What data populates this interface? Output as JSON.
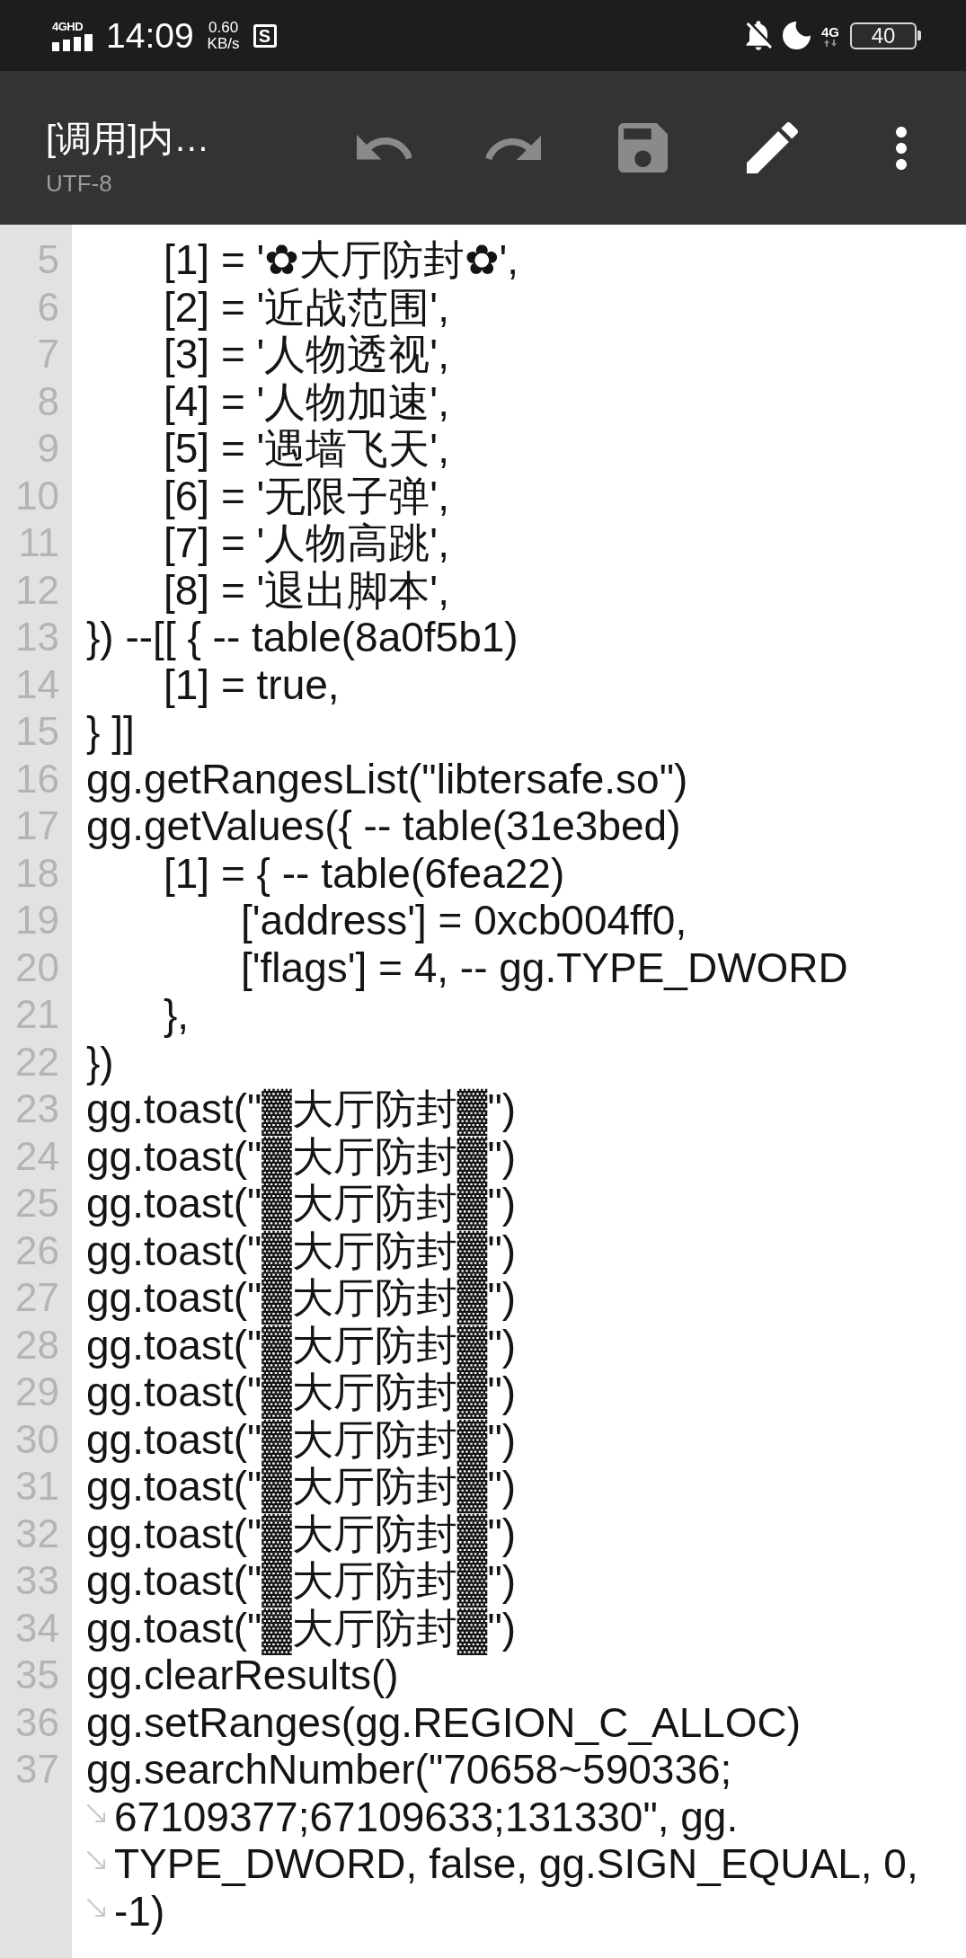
{
  "status_bar": {
    "network_type": "4GHD",
    "time": "14:09",
    "speed_value": "0.60",
    "speed_unit": "KB/s",
    "notification_letter": "S",
    "mobile_data": "4G",
    "battery": "40"
  },
  "toolbar": {
    "title": "[调用]内…",
    "encoding": "UTF-8",
    "actions": [
      {
        "kind": "undo",
        "disabled": true
      },
      {
        "kind": "redo",
        "disabled": true
      },
      {
        "kind": "save",
        "disabled": true
      },
      {
        "kind": "edit",
        "disabled": false
      },
      {
        "kind": "more",
        "disabled": false
      }
    ]
  },
  "editor": {
    "lines": [
      {
        "number": "5",
        "rows": [
          "\t[1] = '✿大厅防封✿',"
        ]
      },
      {
        "number": "6",
        "rows": [
          "\t[2] = '近战范围',"
        ]
      },
      {
        "number": "7",
        "rows": [
          "\t[3] = '人物透视',"
        ]
      },
      {
        "number": "8",
        "rows": [
          "\t[4] = '人物加速',"
        ]
      },
      {
        "number": "9",
        "rows": [
          "\t[5] = '遇墙飞天',"
        ]
      },
      {
        "number": "10",
        "rows": [
          "\t[6] = '无限子弹',"
        ]
      },
      {
        "number": "11",
        "rows": [
          "\t[7] = '人物高跳',"
        ]
      },
      {
        "number": "12",
        "rows": [
          "\t[8] = '退出脚本',"
        ]
      },
      {
        "number": "13",
        "rows": [
          "}) --[[ { -- table(8a0f5b1)"
        ]
      },
      {
        "number": "14",
        "rows": [
          "\t[1] = true,"
        ]
      },
      {
        "number": "15",
        "rows": [
          "} ]]"
        ]
      },
      {
        "number": "16",
        "rows": [
          "gg.getRangesList(\"libtersafe.so\")"
        ]
      },
      {
        "number": "17",
        "rows": [
          "gg.getValues({ -- table(31e3bed)"
        ]
      },
      {
        "number": "18",
        "rows": [
          "\t[1] = { -- table(6fea22)"
        ]
      },
      {
        "number": "19",
        "rows": [
          "\t\t['address'] = 0xcb004ff0,"
        ]
      },
      {
        "number": "20",
        "rows": [
          "\t\t['flags'] = 4, -- gg.TYPE_DWORD"
        ]
      },
      {
        "number": "21",
        "rows": [
          "\t},"
        ]
      },
      {
        "number": "22",
        "rows": [
          "})"
        ]
      },
      {
        "number": "23",
        "rows": [
          "gg.toast(\"▓大厅防封▓\")"
        ]
      },
      {
        "number": "24",
        "rows": [
          "gg.toast(\"▓大厅防封▓\")"
        ]
      },
      {
        "number": "25",
        "rows": [
          "gg.toast(\"▓大厅防封▓\")"
        ]
      },
      {
        "number": "26",
        "rows": [
          "gg.toast(\"▓大厅防封▓\")"
        ]
      },
      {
        "number": "27",
        "rows": [
          "gg.toast(\"▓大厅防封▓\")"
        ]
      },
      {
        "number": "28",
        "rows": [
          "gg.toast(\"▓大厅防封▓\")"
        ]
      },
      {
        "number": "29",
        "rows": [
          "gg.toast(\"▓大厅防封▓\")"
        ]
      },
      {
        "number": "30",
        "rows": [
          "gg.toast(\"▓大厅防封▓\")"
        ]
      },
      {
        "number": "31",
        "rows": [
          "gg.toast(\"▓大厅防封▓\")"
        ]
      },
      {
        "number": "32",
        "rows": [
          "gg.toast(\"▓大厅防封▓\")"
        ]
      },
      {
        "number": "33",
        "rows": [
          "gg.toast(\"▓大厅防封▓\")"
        ]
      },
      {
        "number": "34",
        "rows": [
          "gg.toast(\"▓大厅防封▓\")"
        ]
      },
      {
        "number": "35",
        "rows": [
          "gg.clearResults()"
        ]
      },
      {
        "number": "36",
        "rows": [
          "gg.setRanges(gg.REGION_C_ALLOC)"
        ]
      },
      {
        "number": "37",
        "rows": [
          "gg.searchNumber(\"70658~590336;",
          "67109377;67109633;131330\", gg.",
          "TYPE_DWORD, false, gg.SIGN_EQUAL, 0,",
          "-1)"
        ]
      }
    ]
  }
}
